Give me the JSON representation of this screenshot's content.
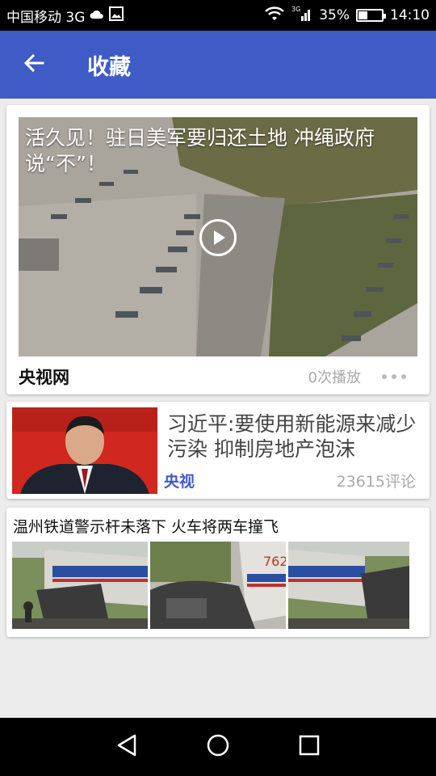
{
  "status_bar": {
    "carrier": "中国移动 3G",
    "battery": "35%",
    "time": "14:10",
    "icons": [
      "cloud-icon",
      "image-icon",
      "wifi-icon",
      "signal-3g-icon",
      "battery-icon"
    ]
  },
  "app_bar": {
    "title": "收藏",
    "back_icon": "arrow-left-icon",
    "background": "#3f5bc6"
  },
  "video_card": {
    "title": "活久见！驻日美军要归还土地 冲绳政府说“不”！",
    "source": "央视网",
    "play_count": "0次播放",
    "play_icon": "play-icon",
    "more_icon": "more-horizontal-icon"
  },
  "news_card": {
    "title": "习近平:要使用新能源来减少污染 抑制房地产泡沫",
    "source": "央视",
    "comments": "23615评论",
    "source_color": "#3f5bc6"
  },
  "gallery_card": {
    "title": "温州铁道警示杆未落下 火车将两车撞飞",
    "image_count": 3
  },
  "nav_bar": {
    "icons": [
      "back-triangle-icon",
      "home-circle-icon",
      "recents-square-icon"
    ]
  }
}
